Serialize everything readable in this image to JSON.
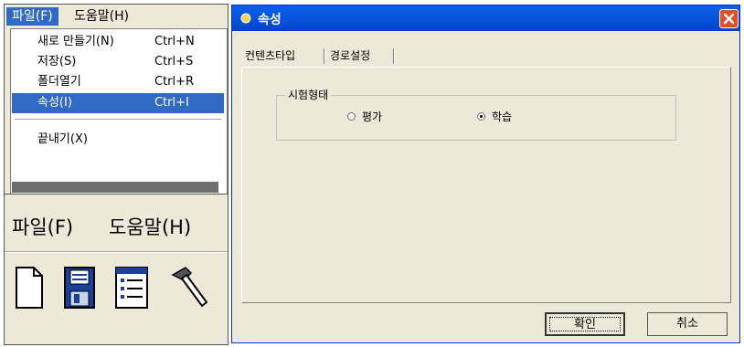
{
  "file_menu": {
    "menubar": [
      "파일(F)",
      "도움말(H)"
    ],
    "items": [
      {
        "label": "새로 만들기(N)",
        "shortcut": "Ctrl+N"
      },
      {
        "label": "저장(S)",
        "shortcut": "Ctrl+S"
      },
      {
        "label": "폴더열기",
        "shortcut": "Ctrl+R"
      },
      {
        "label": "속성(I)",
        "shortcut": "Ctrl+I"
      }
    ],
    "exit_label": "끝내기(X)",
    "highlight_color": "#316ac5"
  },
  "toolbar": {
    "menubar": [
      "파일(F)",
      "도움말(H)"
    ],
    "icons": [
      "new-document-icon",
      "save-disk-icon",
      "properties-list-icon",
      "tools-hammer-icon"
    ]
  },
  "dialog": {
    "title": "속성",
    "tabs": [
      "컨텐츠타입",
      "경로설정"
    ],
    "group_label": "시험형태",
    "options": [
      {
        "label": "평가",
        "selected": false
      },
      {
        "label": "학습",
        "selected": true
      }
    ],
    "ok_label": "확인",
    "cancel_label": "취소",
    "titlebar_color": "#0651d8"
  }
}
